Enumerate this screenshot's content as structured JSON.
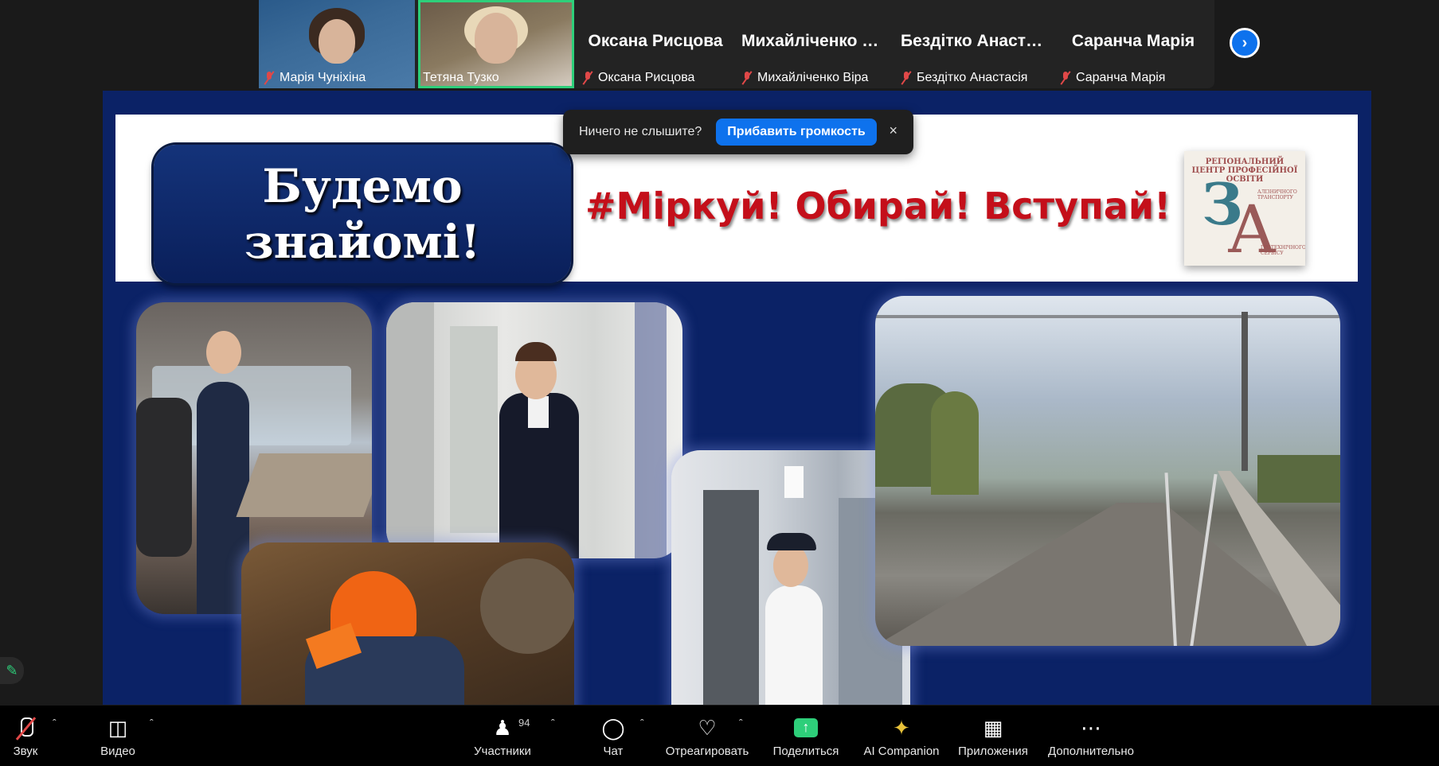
{
  "gallery": {
    "tiles": [
      {
        "name": "Марія Чуніхіна",
        "type": "video"
      },
      {
        "name": "Тетяна Тузко",
        "type": "video-active"
      },
      {
        "name": "Оксана Рисцова",
        "big": "Оксана Рисцова"
      },
      {
        "name": "Михайліченко Віра",
        "big": "Михайліченко Віра"
      },
      {
        "name": "Бездітко Анастасія",
        "big": "Бездітко Анастасія"
      },
      {
        "name": "Саранча Марія",
        "big": "Саранча Марія"
      }
    ],
    "next_icon": "chevron-right-icon"
  },
  "slide": {
    "title_line1": "Будемо",
    "title_line2": "знайомі!",
    "hashtag": "#Міркуй! Обирай! Вступай!",
    "logo": {
      "top_text": "РЕГІОНАЛЬНИЙ ЦЕНТР ПРОФЕСІЙНОЇ ОСВІТИ",
      "letter1": "З",
      "letter2": "А",
      "small1": "АЛІЗНИЧНОГО ТРАНСПОРТУ",
      "small2": "ГРОТЕХНІЧНОГО СЕРВІСУ"
    }
  },
  "toast": {
    "message": "Ничего не слышите?",
    "button": "Прибавить громкость",
    "close": "×"
  },
  "toolbar": {
    "audio": "Звук",
    "video": "Видео",
    "participants": "Участники",
    "participants_count": "94",
    "chat": "Чат",
    "react": "Отреагировать",
    "share": "Поделиться",
    "ai": "AI Companion",
    "apps": "Приложения",
    "more": "Дополнительно"
  },
  "colors": {
    "accent": "#0e72ed",
    "share_green": "#2ecf7a",
    "slide_navy": "#0b2266",
    "hashtag_red": "#c40f1a",
    "mute_red": "#e04848"
  }
}
